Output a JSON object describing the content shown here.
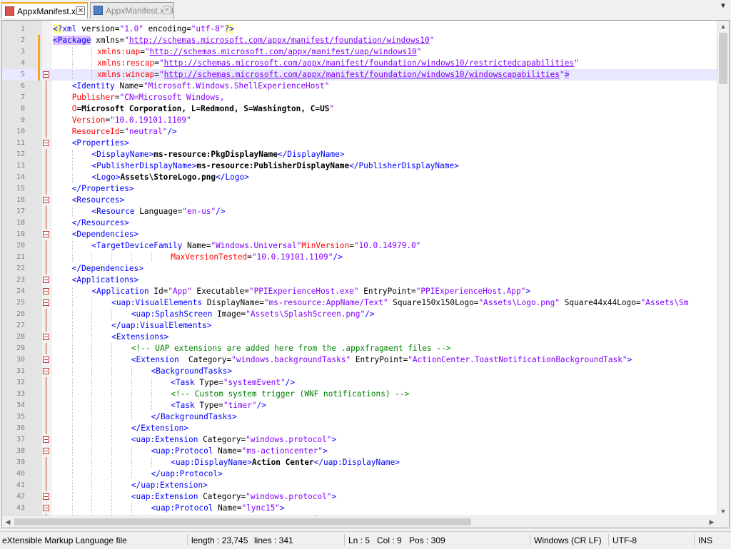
{
  "tabs": [
    {
      "label": "AppxManifest.xml",
      "active": true
    },
    {
      "label": "AppxManifest.xml",
      "active": false
    }
  ],
  "status": {
    "filetype": "eXtensible Markup Language file",
    "length": "length : 23,745",
    "lines": "lines : 341",
    "ln": "Ln : 5",
    "col": "Col : 9",
    "pos": "Pos : 309",
    "eol": "Windows (CR LF)",
    "encoding": "UTF-8",
    "mode": "INS"
  },
  "colors": {
    "tag": "#0000ff",
    "attribute": "#ff0000",
    "value": "#8000ff",
    "comment": "#008000",
    "fold": "#c0392b",
    "change_marker": "#f5a623"
  },
  "editor": {
    "current_line": 5,
    "lines": [
      "<?xml version=\"1.0\" encoding=\"utf-8\"?>",
      "<Package xmlns=\"http://schemas.microsoft.com/appx/manifest/foundation/windows10\"",
      "         xmlns:uap=\"http://schemas.microsoft.com/appx/manifest/uap/windows10\"",
      "         xmlns:rescap=\"http://schemas.microsoft.com/appx/manifest/foundation/windows10/restrictedcapabilities\"",
      "         xmlns:wincap=\"http://schemas.microsoft.com/appx/manifest/foundation/windows10/windowscapabilities\">",
      "    <Identity Name=\"Microsoft.Windows.ShellExperienceHost\"",
      "    Publisher=\"CN=Microsoft Windows,",
      "    O=Microsoft Corporation, L=Redmond, S=Washington, C=US\"",
      "    Version=\"10.0.19101.1109\"",
      "    ResourceId=\"neutral\"/>",
      "    <Properties>",
      "        <DisplayName>ms-resource:PkgDisplayName</DisplayName>",
      "        <PublisherDisplayName>ms-resource:PublisherDisplayName</PublisherDisplayName>",
      "        <Logo>Assets\\StoreLogo.png</Logo>",
      "    </Properties>",
      "    <Resources>",
      "        <Resource Language=\"en-us\"/>",
      "    </Resources>",
      "    <Dependencies>",
      "        <TargetDeviceFamily Name=\"Windows.Universal\"MinVersion=\"10.0.14979.0\"",
      "                        MaxVersionTested=\"10.0.19101.1109\"/>",
      "    </Dependencies>",
      "    <Applications>",
      "        <Application Id=\"App\" Executable=\"PPIExperienceHost.exe\" EntryPoint=\"PPIExperienceHost.App\">",
      "            <uap:VisualElements DisplayName=\"ms-resource:AppName/Text\" Square150x150Logo=\"Assets\\Logo.png\" Square44x44Logo=\"Assets\\Sm",
      "                <uap:SplashScreen Image=\"Assets\\SplashScreen.png\"/>",
      "            </uap:VisualElements>",
      "            <Extensions>",
      "                <!-- UAP extensions are added here from the .appxfragment files -->",
      "                <Extension  Category=\"windows.backgroundTasks\" EntryPoint=\"ActionCenter.ToastNotificationBackgroundTask\">",
      "                    <BackgroundTasks>",
      "                        <Task Type=\"systemEvent\"/>",
      "                        <!-- Custom system trigger (WNF notifications) -->",
      "                        <Task Type=\"timer\"/>",
      "                    </BackgroundTasks>",
      "                </Extension>",
      "                <uap:Extension Category=\"windows.protocol\">",
      "                    <uap:Protocol Name=\"ms-actioncenter\">",
      "                        <uap:DisplayName>Action Center</uap:DisplayName>",
      "                    </uap:Protocol>",
      "                </uap:Extension>",
      "                <uap:Extension Category=\"windows.protocol\">",
      "                    <uap:Protocol Name=\"lync15\">",
      "                        <uap:DisplayName>Skype for Business</uap:DisplayName>"
    ]
  }
}
